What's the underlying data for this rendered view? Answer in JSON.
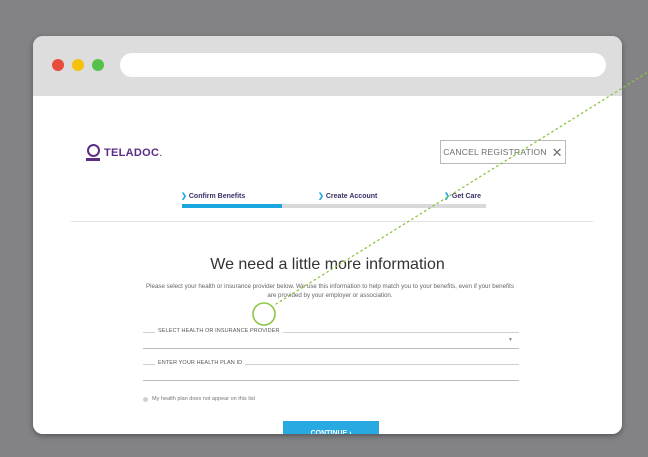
{
  "browser": {
    "window_controls": [
      "close",
      "minimize",
      "maximize"
    ],
    "url": ""
  },
  "header": {
    "logo_text": "TELADOC",
    "logo_mark": ".",
    "cancel_label": "CANCEL REGISTRATION"
  },
  "steps": [
    {
      "label": "Confirm Benefits",
      "active": true
    },
    {
      "label": "Create Account",
      "active": false
    },
    {
      "label": "Get Care",
      "active": false
    }
  ],
  "progress": {
    "fraction": 0.33
  },
  "main": {
    "heading": "We need a little more information",
    "description": "Please select your health or insurance provider below. We use this information to help match you to your benefits, even if your benefits are provided by your employer or association.",
    "provider_label": "SELECT HEALTH OR INSURANCE PROVIDER",
    "plan_id_label": "ENTER YOUR HEALTH PLAN ID",
    "checkbox_label": "My health plan does not appear on this list",
    "continue_label": "CONTINUE ›"
  },
  "colors": {
    "brand_purple": "#5b2d86",
    "accent_blue": "#29a9e1",
    "annotation_green": "#8cc63f"
  }
}
